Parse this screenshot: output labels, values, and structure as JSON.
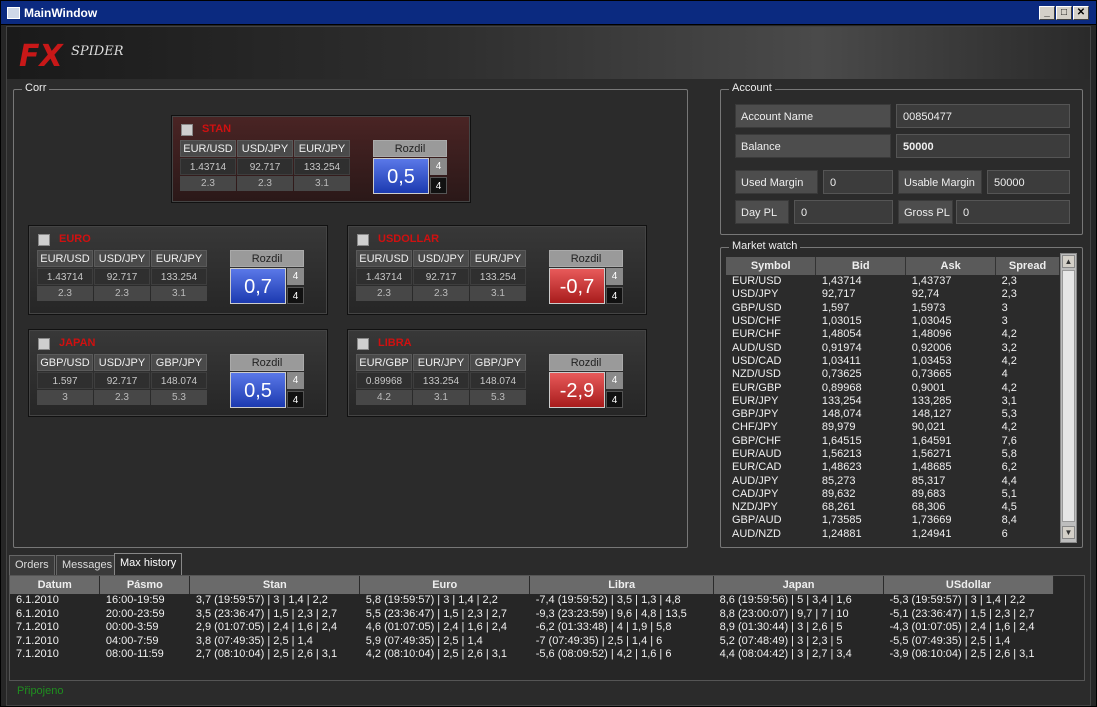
{
  "window": {
    "title": "MainWindow"
  },
  "logo": {
    "fx": "FX",
    "spider": "SPIDER"
  },
  "corr": {
    "title": "Corr",
    "panels": [
      {
        "name": "STAN",
        "pairs": [
          {
            "sym": "EUR/USD",
            "val": "1.43714",
            "spr": "2.3"
          },
          {
            "sym": "USD/JPY",
            "val": "92.717",
            "spr": "2.3"
          },
          {
            "sym": "EUR/JPY",
            "val": "133.254",
            "spr": "3.1"
          }
        ],
        "rozdil_label": "Rozdil",
        "rozdil": "0,5",
        "s1": "4",
        "s2": "4",
        "color": "blue"
      },
      {
        "name": "EURO",
        "pairs": [
          {
            "sym": "EUR/USD",
            "val": "1.43714",
            "spr": "2.3"
          },
          {
            "sym": "USD/JPY",
            "val": "92.717",
            "spr": "2.3"
          },
          {
            "sym": "EUR/JPY",
            "val": "133.254",
            "spr": "3.1"
          }
        ],
        "rozdil_label": "Rozdil",
        "rozdil": "0,7",
        "s1": "4",
        "s2": "4",
        "color": "blue"
      },
      {
        "name": "USDOLLAR",
        "pairs": [
          {
            "sym": "EUR/USD",
            "val": "1.43714",
            "spr": "2.3"
          },
          {
            "sym": "USD/JPY",
            "val": "92.717",
            "spr": "2.3"
          },
          {
            "sym": "EUR/JPY",
            "val": "133.254",
            "spr": "3.1"
          }
        ],
        "rozdil_label": "Rozdil",
        "rozdil": "-0,7",
        "s1": "4",
        "s2": "4",
        "color": "red"
      },
      {
        "name": "JAPAN",
        "pairs": [
          {
            "sym": "GBP/USD",
            "val": "1.597",
            "spr": "3"
          },
          {
            "sym": "USD/JPY",
            "val": "92.717",
            "spr": "2.3"
          },
          {
            "sym": "GBP/JPY",
            "val": "148.074",
            "spr": "5.3"
          }
        ],
        "rozdil_label": "Rozdil",
        "rozdil": "0,5",
        "s1": "4",
        "s2": "4",
        "color": "blue"
      },
      {
        "name": "LIBRA",
        "pairs": [
          {
            "sym": "EUR/GBP",
            "val": "0.89968",
            "spr": "4.2"
          },
          {
            "sym": "EUR/JPY",
            "val": "133.254",
            "spr": "3.1"
          },
          {
            "sym": "GBP/JPY",
            "val": "148.074",
            "spr": "5.3"
          }
        ],
        "rozdil_label": "Rozdil",
        "rozdil": "-2,9",
        "s1": "4",
        "s2": "4",
        "color": "red"
      }
    ]
  },
  "account": {
    "title": "Account",
    "account_name_label": "Account Name",
    "account_name": "00850477",
    "balance_label": "Balance",
    "balance": "50000",
    "used_margin_label": "Used Margin",
    "used_margin": "0",
    "usable_margin_label": "Usable Margin",
    "usable_margin": "50000",
    "day_pl_label": "Day PL",
    "day_pl": "0",
    "gross_pl_label": "Gross PL",
    "gross_pl": "0"
  },
  "market": {
    "title": "Market watch",
    "headers": [
      "Symbol",
      "Bid",
      "Ask",
      "Spread"
    ],
    "rows": [
      [
        "EUR/USD",
        "1,43714",
        "1,43737",
        "2,3"
      ],
      [
        "USD/JPY",
        "92,717",
        "92,74",
        "2,3"
      ],
      [
        "GBP/USD",
        "1,597",
        "1,5973",
        "3"
      ],
      [
        "USD/CHF",
        "1,03015",
        "1,03045",
        "3"
      ],
      [
        "EUR/CHF",
        "1,48054",
        "1,48096",
        "4,2"
      ],
      [
        "AUD/USD",
        "0,91974",
        "0,92006",
        "3,2"
      ],
      [
        "USD/CAD",
        "1,03411",
        "1,03453",
        "4,2"
      ],
      [
        "NZD/USD",
        "0,73625",
        "0,73665",
        "4"
      ],
      [
        "EUR/GBP",
        "0,89968",
        "0,9001",
        "4,2"
      ],
      [
        "EUR/JPY",
        "133,254",
        "133,285",
        "3,1"
      ],
      [
        "GBP/JPY",
        "148,074",
        "148,127",
        "5,3"
      ],
      [
        "CHF/JPY",
        "89,979",
        "90,021",
        "4,2"
      ],
      [
        "GBP/CHF",
        "1,64515",
        "1,64591",
        "7,6"
      ],
      [
        "EUR/AUD",
        "1,56213",
        "1,56271",
        "5,8"
      ],
      [
        "EUR/CAD",
        "1,48623",
        "1,48685",
        "6,2"
      ],
      [
        "AUD/JPY",
        "85,273",
        "85,317",
        "4,4"
      ],
      [
        "CAD/JPY",
        "89,632",
        "89,683",
        "5,1"
      ],
      [
        "NZD/JPY",
        "68,261",
        "68,306",
        "4,5"
      ],
      [
        "GBP/AUD",
        "1,73585",
        "1,73669",
        "8,4"
      ],
      [
        "AUD/NZD",
        "1,24881",
        "1,24941",
        "6"
      ]
    ]
  },
  "tabs": [
    "Orders",
    "Messages",
    "Max history"
  ],
  "history": {
    "headers": [
      "Datum",
      "Pásmo",
      "Stan",
      "Euro",
      "Libra",
      "Japan",
      "USdollar"
    ],
    "rows": [
      [
        "6.1.2010",
        "16:00-19:59",
        "3,7 (19:59:57) | 3 | 1,4 | 2,2",
        "5,8 (19:59:57) | 3 | 1,4 | 2,2",
        "-7,4 (19:59:52) | 3,5 | 1,3 | 4,8",
        "8,6 (19:59:56) | 5 | 3,4 | 1,6",
        "-5,3 (19:59:57) | 3 | 1,4 | 2,2"
      ],
      [
        "6.1.2010",
        "20:00-23:59",
        "3,5 (23:36:47) | 1,5 | 2,3 | 2,7",
        "5,5 (23:36:47) | 1,5 | 2,3 | 2,7",
        "-9,3 (23:23:59) | 9,6 | 4,8 | 13,5",
        "8,8 (23:00:07) | 9,7 | 7 | 10",
        "-5,1 (23:36:47) | 1,5 | 2,3 | 2,7"
      ],
      [
        "7.1.2010",
        "00:00-3:59",
        "2,9 (01:07:05) | 2,4 | 1,6 | 2,4",
        "4,6 (01:07:05) | 2,4 | 1,6 | 2,4",
        "-6,2 (01:33:48) | 4 | 1,9 | 5,8",
        "8,9 (01:30:44) | 3 | 2,6 | 5",
        "-4,3 (01:07:05) | 2,4 | 1,6 | 2,4"
      ],
      [
        "7.1.2010",
        "04:00-7:59",
        "3,8 (07:49:35) | 2,5 | 1,4",
        "5,9 (07:49:35) | 2,5 | 1,4",
        "-7 (07:49:35) | 2,5 | 1,4 | 6",
        "5,2 (07:48:49) | 3 | 2,3 | 5",
        "-5,5 (07:49:35) | 2,5 | 1,4"
      ],
      [
        "7.1.2010",
        "08:00-11:59",
        "2,7 (08:10:04) | 2,5 | 2,6 | 3,1",
        "4,2 (08:10:04) | 2,5 | 2,6 | 3,1",
        "-5,6 (08:09:52) | 4,2 | 1,6 | 6",
        "4,4 (08:04:42) | 3 | 2,7 | 3,4",
        "-3,9 (08:10:04) | 2,5 | 2,6 | 3,1"
      ]
    ]
  },
  "status": "Připojeno"
}
